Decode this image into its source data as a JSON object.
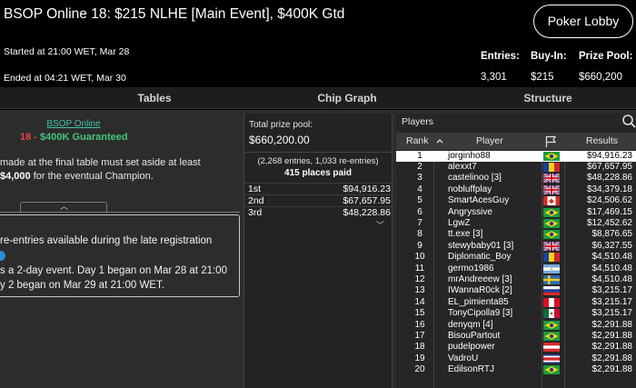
{
  "header": {
    "title": "BSOP Online 18: $215 NLHE [Main Event],  $400K Gtd",
    "started": "Started at 21:00 WET, Mar 28",
    "ended": "Ended at 04:21 WET, Mar 30",
    "lobby_button": "Poker Lobby",
    "stats": [
      {
        "label": "Entries:",
        "value": "3,301"
      },
      {
        "label": "Buy-In:",
        "value": "$215"
      },
      {
        "label": "Prize Pool:",
        "value": "$660,200"
      }
    ]
  },
  "tabs": [
    "Tables",
    "Chip Graph",
    "Structure"
  ],
  "left_panel": {
    "link": "BSOP Online",
    "guarantee_number": "18",
    "guarantee_sep": " - ",
    "guarantee_text": "$400K Guaranteed",
    "text_line1": "made at the final table must set aside at least",
    "text_amount": "$4,000",
    "text_line2_rest": " for the eventual Champion.",
    "info_line1": "re-entries available during the late registration",
    "info_line2": "s a 2-day event. Day 1 began on Mar 28 at 21:00",
    "info_line3": "y 2 began on Mar 29 at 21:00 WET."
  },
  "prize_panel": {
    "label": "Total prize pool:",
    "value": "$660,200.00",
    "entries_note": "(2,268 entries, 1,033 re-entries)",
    "places_paid": "415 places paid",
    "prizes": [
      {
        "place": "1st",
        "amount": "$94,916.23"
      },
      {
        "place": "2nd",
        "amount": "$67,657.95"
      },
      {
        "place": "3rd",
        "amount": "$48,228.86"
      }
    ]
  },
  "players_panel": {
    "title": "Players",
    "columns": {
      "rank": "Rank",
      "player": "Player",
      "results": "Results"
    },
    "rows": [
      {
        "rank": "1",
        "player": "jorginho88",
        "flag": "br",
        "result": "$94,916.23"
      },
      {
        "rank": "2",
        "player": "alexxt7",
        "flag": "ro",
        "result": "$67,657.95"
      },
      {
        "rank": "3",
        "player": "castelinoo [3]",
        "flag": "gb",
        "result": "$48,228.86"
      },
      {
        "rank": "4",
        "player": "nobluffplay",
        "flag": "gb",
        "result": "$34,379.18"
      },
      {
        "rank": "5",
        "player": "SmartAcesGuy",
        "flag": "ca",
        "result": "$24,506.62"
      },
      {
        "rank": "6",
        "player": "Angryssive",
        "flag": "br",
        "result": "$17,469.15"
      },
      {
        "rank": "7",
        "player": "LgwZ",
        "flag": "br",
        "result": "$12,452.62"
      },
      {
        "rank": "8",
        "player": "tt.exe [3]",
        "flag": "br",
        "result": "$8,876.65"
      },
      {
        "rank": "9",
        "player": "stewybaby01 [3]",
        "flag": "gb",
        "result": "$6,327.55"
      },
      {
        "rank": "10",
        "player": "Diplomatic_Boy",
        "flag": "ro",
        "result": "$4,510.48"
      },
      {
        "rank": "11",
        "player": "germo1986",
        "flag": "ar",
        "result": "$4,510.48"
      },
      {
        "rank": "12",
        "player": "mrAndreeew [3]",
        "flag": "se",
        "result": "$4,510.48"
      },
      {
        "rank": "13",
        "player": "IWannaR0ck [2]",
        "flag": "ru",
        "result": "$3,215.17"
      },
      {
        "rank": "14",
        "player": "EL_pimienta85",
        "flag": "pe",
        "result": "$3,215.17"
      },
      {
        "rank": "15",
        "player": "TonyCipolla9 [3]",
        "flag": "mx",
        "result": "$3,215.17"
      },
      {
        "rank": "16",
        "player": "denyqm [4]",
        "flag": "br",
        "result": "$2,291.88"
      },
      {
        "rank": "17",
        "player": "BisouPartout",
        "flag": "br",
        "result": "$2,291.88"
      },
      {
        "rank": "18",
        "player": "pudelpower",
        "flag": "at",
        "result": "$2,291.88"
      },
      {
        "rank": "19",
        "player": "VadroU",
        "flag": "cr",
        "result": "$2,291.88"
      },
      {
        "rank": "20",
        "player": "EdilsonRTJ",
        "flag": "br",
        "result": "$2,291.88"
      }
    ]
  },
  "colors": {
    "accent_teal": "#3fc0a6",
    "red": "#e74848",
    "green": "#43c47a",
    "info_blue": "#2b8fd6"
  }
}
